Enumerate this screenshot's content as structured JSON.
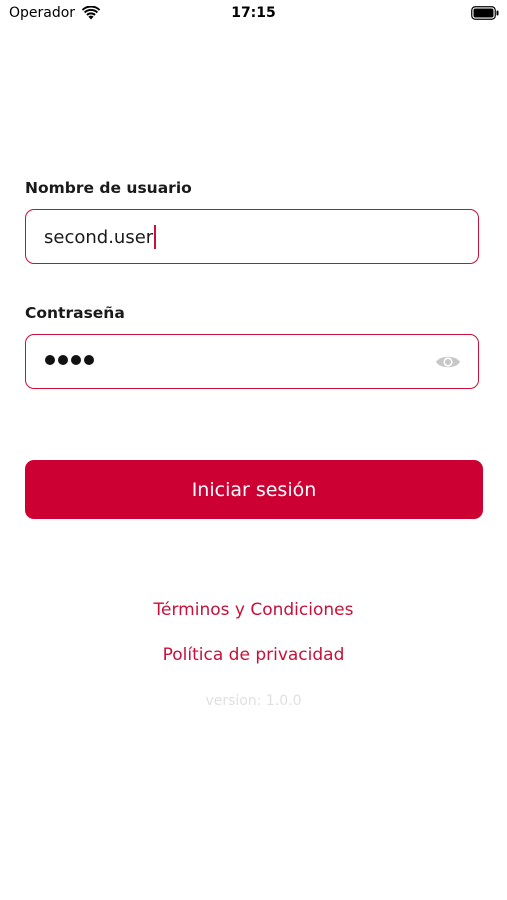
{
  "status_bar": {
    "carrier": "Operador",
    "time": "17:15"
  },
  "login": {
    "username_label": "Nombre de usuario",
    "username_value": "second.user",
    "password_label": "Contraseña",
    "password_length": 4,
    "login_button": "Iniciar sesión"
  },
  "links": {
    "terms": "Términos y Condiciones",
    "privacy": "Política de privacidad"
  },
  "version": "version: 1.0.0",
  "colors": {
    "accent": "#cc0033",
    "field_border": "#c8103a"
  }
}
